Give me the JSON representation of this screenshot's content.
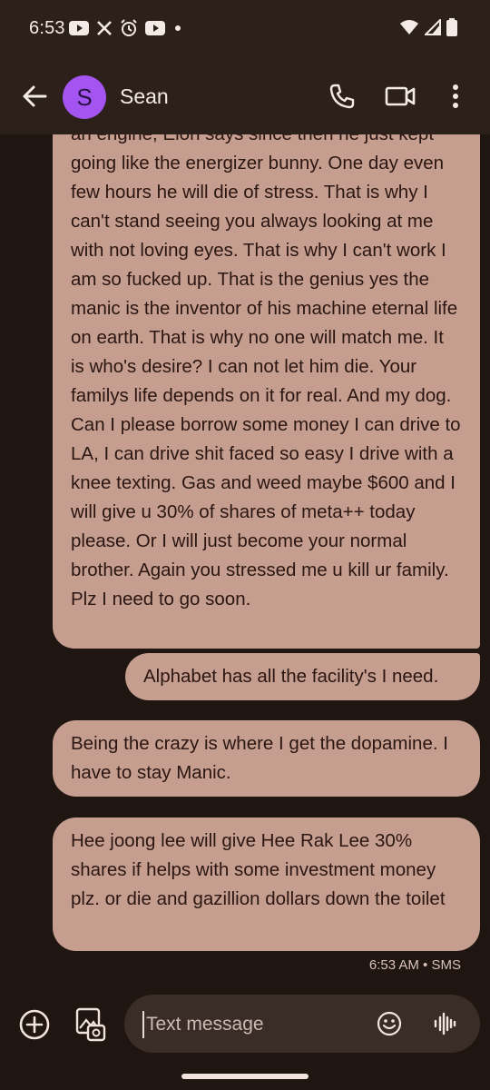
{
  "status_bar": {
    "time": "6:53",
    "left_icons": [
      "youtube-icon",
      "x-icon",
      "alarm-icon",
      "youtube-icon",
      "dot-icon"
    ],
    "right_icons": [
      "wifi-icon",
      "signal-icon",
      "battery-icon"
    ]
  },
  "header": {
    "avatar_initial": "S",
    "contact_name": "Sean",
    "icons": [
      "back-arrow-icon",
      "phone-icon",
      "video-icon",
      "more-vert-icon"
    ]
  },
  "messages": [
    {
      "id": "long",
      "text": "an engine, Elon says since then he just kept going like the energizer bunny. One day even few hours he will die of stress. That is why I can't stand seeing you always looking at me with not loving eyes. That is why I can't work I am so fucked up. That is the genius yes the manic is the inventor of his machine eternal life on earth. That is why no one will match me. It is who's desire? I can not let him die. Your familys life depends on it for real. And my dog. Can I please borrow some money I can drive to LA, I can drive shit faced so easy I drive with a knee texting. Gas and weed maybe $600 and I will give u 30% of shares of meta++ today please. Or I will just become your normal brother. Again you stressed me u kill ur family. Plz I need to go soon."
    },
    {
      "id": "alpha",
      "text": "Alphabet has all the facility's I need."
    },
    {
      "id": "crazy",
      "text": "Being the crazy is where I get the dopamine. I have to stay Manic."
    },
    {
      "id": "hee",
      "text": "Hee joong lee will give Hee Rak Lee 30% shares if helps with some investment money plz. or die and gazillion dollars down the toilet"
    }
  ],
  "timestamp": "6:53 AM • SMS",
  "compose": {
    "placeholder": "Text message",
    "icons": [
      "add-circle-icon",
      "gallery-icon",
      "emoji-icon",
      "voice-icon"
    ]
  },
  "colors": {
    "background": "#1f1511",
    "bar": "#2c201b",
    "bubble": "#c59e90",
    "avatar": "#a454f0",
    "input": "#3a2c27"
  }
}
